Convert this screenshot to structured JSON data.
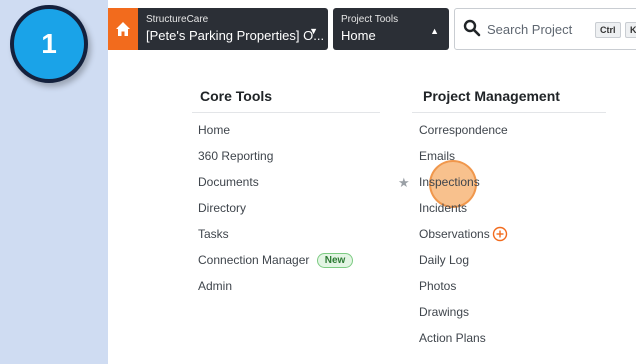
{
  "step": {
    "number": "1"
  },
  "topbar": {
    "company": {
      "small": "StructureCare",
      "main": "[Pete's Parking Properties] O..."
    },
    "tools": {
      "small": "Project Tools",
      "main": "Home"
    },
    "search": {
      "placeholder": "Search Project",
      "kbd1": "Ctrl",
      "kbd2": "K"
    }
  },
  "core_tools": {
    "title": "Core Tools",
    "items": [
      "Home",
      "360 Reporting",
      "Documents",
      "Directory",
      "Tasks",
      "Connection Manager",
      "Admin"
    ],
    "new_badge": "New"
  },
  "project_management": {
    "title": "Project Management",
    "items": [
      "Correspondence",
      "Emails",
      "Inspections",
      "Incidents",
      "Observations",
      "Daily Log",
      "Photos",
      "Drawings",
      "Action Plans"
    ]
  },
  "colors": {
    "accent": "#f26b1d",
    "topbar_dark": "#2b2f36",
    "badge_blue": "#1aa3e8"
  }
}
